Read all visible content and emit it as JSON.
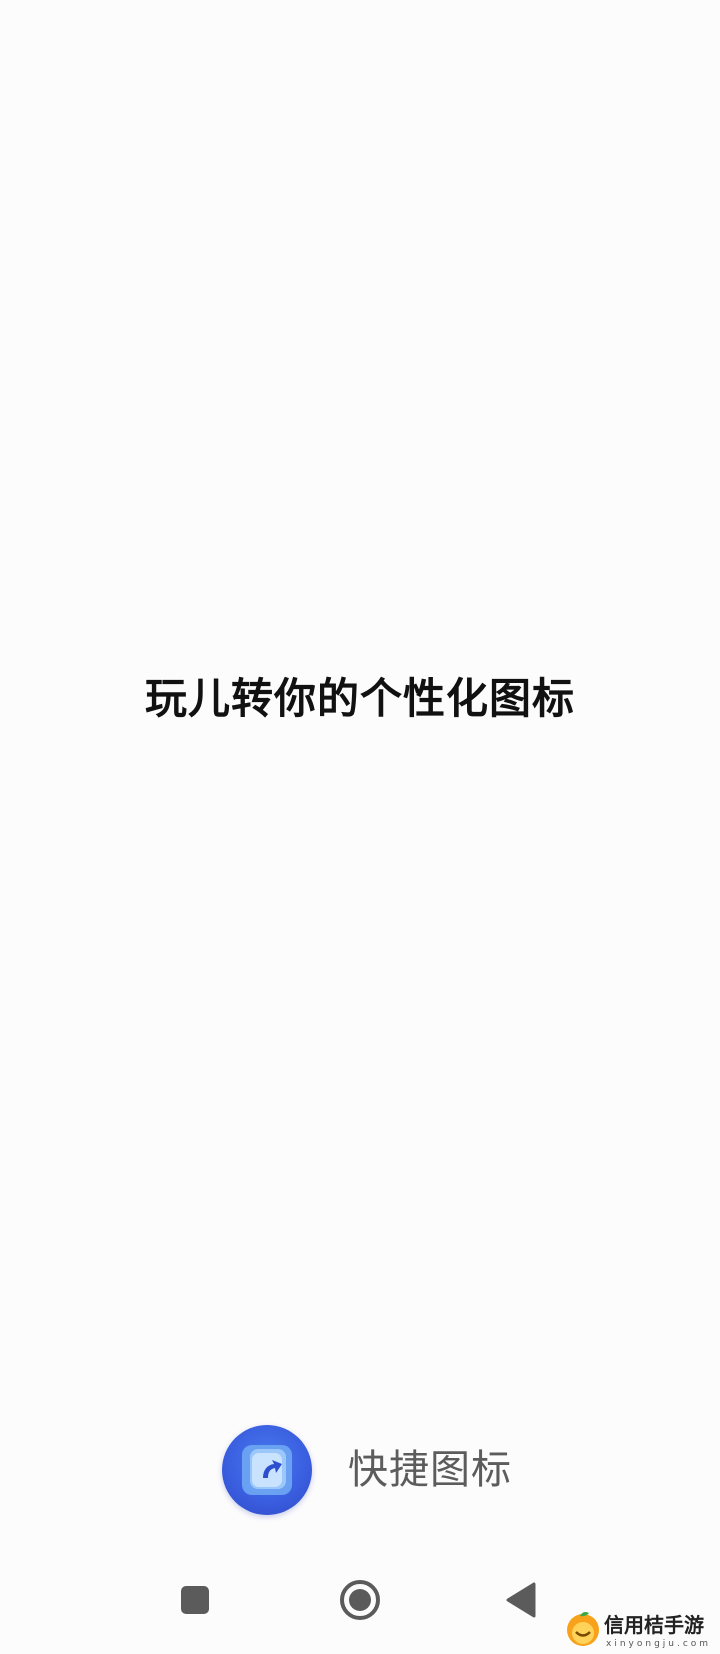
{
  "splash": {
    "tagline": "玩儿转你的个性化图标",
    "app_name": "快捷图标",
    "app_icon": "shortcut-arrow-icon"
  },
  "navigation": {
    "recent": "recent-apps-icon",
    "home": "home-icon",
    "back": "back-icon"
  },
  "watermark": {
    "name": "信用桔手游",
    "url": "xinyongju.com"
  },
  "colors": {
    "background": "#fdfcfd",
    "tagline": "#111111",
    "app_name": "#5c5c5c",
    "icon_blue": "#3a5fe0",
    "nav_icons": "#5b5b5b"
  }
}
